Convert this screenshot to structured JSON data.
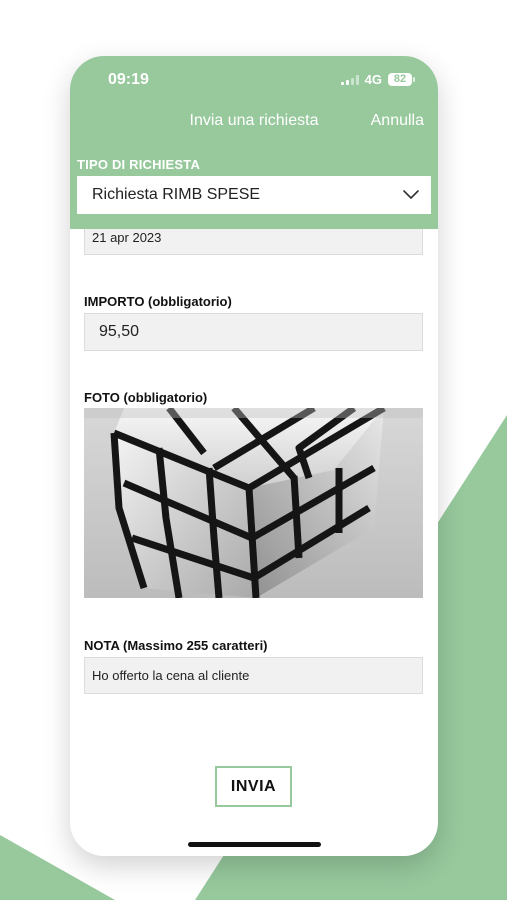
{
  "status_bar": {
    "time": "09:19",
    "network": "4G",
    "battery": "82"
  },
  "nav": {
    "title": "Invia una richiesta",
    "cancel_label": "Annulla"
  },
  "request_type": {
    "label": "TIPO DI RICHIESTA",
    "value": "Richiesta RIMB SPESE"
  },
  "date_field": {
    "value": "21 apr 2023"
  },
  "amount_field": {
    "label": "IMPORTO (obbligatorio)",
    "value": "95,50"
  },
  "photo_field": {
    "label": "FOTO (obbligatorio)"
  },
  "note_field": {
    "label": "NOTA (Massimo 255 caratteri)",
    "value": "Ho offerto la cena al cliente"
  },
  "submit": {
    "label": "INVIA"
  },
  "colors": {
    "accent": "#97c99d",
    "field_bg": "#f1f1f1",
    "text": "#111111"
  }
}
